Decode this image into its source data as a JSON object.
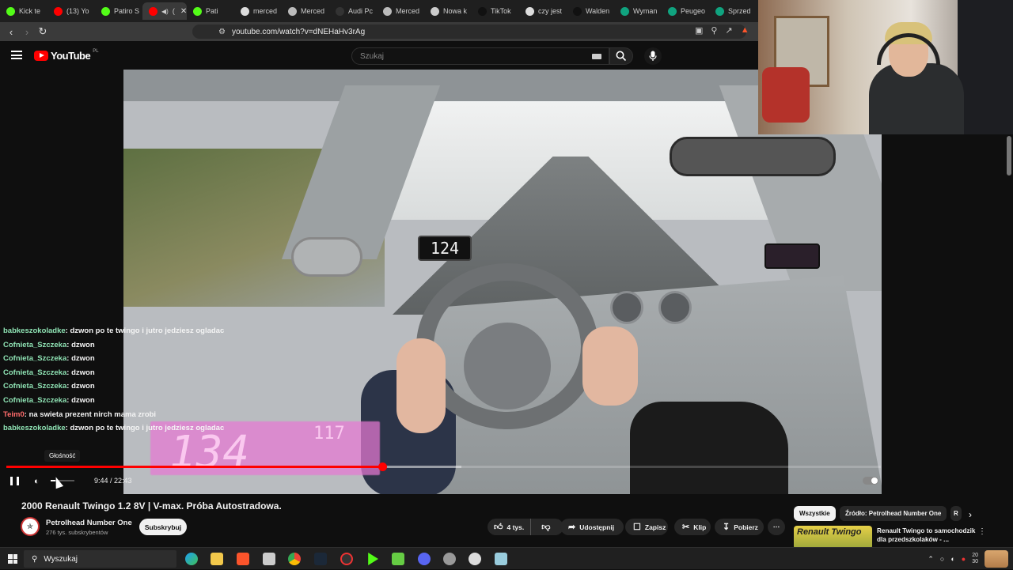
{
  "browser": {
    "tabs": [
      {
        "label": "Kick te",
        "color": "#53fc18",
        "active": false
      },
      {
        "label": "(13) Yo",
        "color": "#ff0000",
        "active": false
      },
      {
        "label": "Patiro S",
        "color": "#53fc18",
        "active": false
      },
      {
        "label": "(",
        "color": "#ff0000",
        "active": true
      },
      {
        "label": "Pati",
        "color": "#53fc18",
        "active": false
      },
      {
        "label": "merced",
        "color": "#dddddd",
        "active": false
      },
      {
        "label": "Merced",
        "color": "#bbbbbb",
        "active": false
      },
      {
        "label": "Audi Pc",
        "color": "#333333",
        "active": false
      },
      {
        "label": "Merced",
        "color": "#bbbbbb",
        "active": false
      },
      {
        "label": "Nowa k",
        "color": "#cccccc",
        "active": false
      },
      {
        "label": "TikTok",
        "color": "#111111",
        "active": false
      },
      {
        "label": "czy jest",
        "color": "#dddddd",
        "active": false
      },
      {
        "label": "Walden",
        "color": "#111111",
        "active": false
      },
      {
        "label": "Wyman",
        "color": "#10a37f",
        "active": false
      },
      {
        "label": "Peugeo",
        "color": "#10a37f",
        "active": false
      },
      {
        "label": "Sprzed",
        "color": "#10a37f",
        "active": false
      }
    ],
    "url": "youtube.com/watch?v=dNEHaHv3rAg"
  },
  "youtube": {
    "logo": "YouTube",
    "region": "PL",
    "search_placeholder": "Szukaj"
  },
  "video": {
    "dash_speed": "124",
    "overlay_speed": "134",
    "overlay_secondary": "117",
    "volume_tooltip": "Głośność",
    "time": "9:44 / 22:43",
    "progress_fraction": 0.43,
    "buffered_fraction": 0.52,
    "volume_fraction": 0.2,
    "badge_icon": "steering-wheel-icon"
  },
  "chat": [
    {
      "user": "babkeszokoladke",
      "text": "dzwon po te twingo i jutro jedziesz ogladac",
      "color": "green"
    },
    {
      "user": "Cofnieta_Szczeka",
      "text": "dzwon",
      "color": "green"
    },
    {
      "user": "Cofnieta_Szczeka",
      "text": "dzwon",
      "color": "green"
    },
    {
      "user": "Cofnieta_Szczeka",
      "text": "dzwon",
      "color": "green"
    },
    {
      "user": "Cofnieta_Szczeka",
      "text": "dzwon",
      "color": "green"
    },
    {
      "user": "Cofnieta_Szczeka",
      "text": "dzwon",
      "color": "green"
    },
    {
      "user": "Teim0",
      "text": "na swieta prezent nirch mama zrobi",
      "color": "red"
    },
    {
      "user": "babkeszokoladke",
      "text": "dzwon po te twingo i jutro jedziesz ogladac",
      "color": "green"
    }
  ],
  "meta": {
    "title": "2000 Renault Twingo 1.2 8V | V-max. Próba Autostradowa.",
    "channel": "Petrolhead Number One",
    "subscribers": "276 tys. subskrybentów",
    "subscribe": "Subskrybuj",
    "likes": "4 tys.",
    "share": "Udostępnij",
    "save": "Zapisz",
    "clip": "Klip",
    "download": "Pobierz"
  },
  "recommendations": {
    "chips": [
      "Wszystkie",
      "Źródło: Petrolhead Number One",
      "R"
    ],
    "items": [
      {
        "thumb_text": "Renault Twingo",
        "title": "Renault Twingo to samochodzik dla przedszkolaków - ..."
      }
    ]
  },
  "taskbar": {
    "search_label": "Wyszukaj",
    "clock_top": "20",
    "clock_bottom": "30"
  }
}
